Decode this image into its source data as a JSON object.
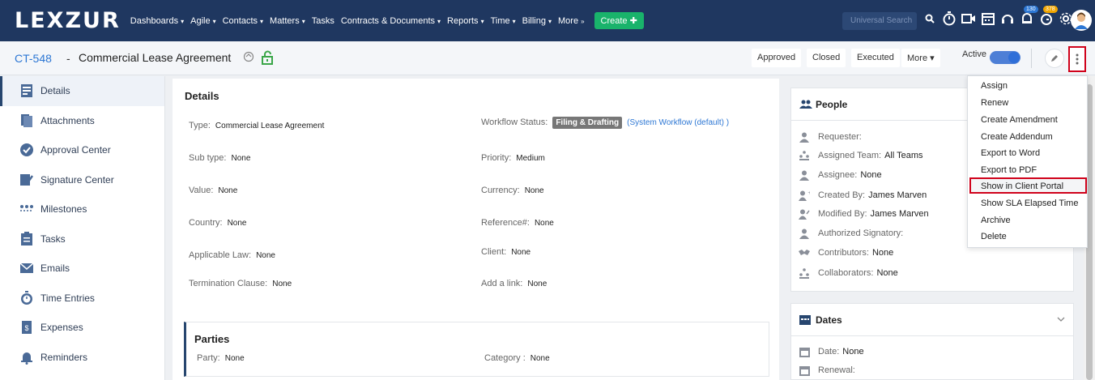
{
  "app": {
    "logo": "LEXZUR"
  },
  "nav": {
    "items": [
      {
        "label": "Dashboards",
        "caret": "▾"
      },
      {
        "label": "Agile",
        "caret": "▾"
      },
      {
        "label": "Contacts",
        "caret": "▾"
      },
      {
        "label": "Matters",
        "caret": "▾"
      },
      {
        "label": "Tasks",
        "caret": ""
      },
      {
        "label": "Contracts & Documents",
        "caret": "▾"
      },
      {
        "label": "Reports",
        "caret": "▾"
      },
      {
        "label": "Time",
        "caret": "▾"
      },
      {
        "label": "Billing",
        "caret": "▾"
      },
      {
        "label": "More",
        "caret": "»"
      }
    ],
    "create_label": "Create ✚",
    "search_placeholder": "Universal Search",
    "badge_notifications": "130",
    "badge_reminders": "378"
  },
  "record": {
    "id": "CT-548",
    "separator": "-",
    "title": "Commercial Lease Agreement",
    "status_buttons": [
      "Approved",
      "Closed",
      "Executed"
    ],
    "more_label": "More ▾",
    "active_label": "Active"
  },
  "sidebar": {
    "items": [
      {
        "label": "Details",
        "icon": "details-icon"
      },
      {
        "label": "Attachments",
        "icon": "attachments-icon"
      },
      {
        "label": "Approval Center",
        "icon": "approval-icon"
      },
      {
        "label": "Signature Center",
        "icon": "signature-icon"
      },
      {
        "label": "Milestones",
        "icon": "milestones-icon"
      },
      {
        "label": "Tasks",
        "icon": "tasks-icon"
      },
      {
        "label": "Emails",
        "icon": "email-icon"
      },
      {
        "label": "Time Entries",
        "icon": "stopwatch-icon"
      },
      {
        "label": "Expenses",
        "icon": "expenses-icon"
      },
      {
        "label": "Reminders",
        "icon": "bell-icon"
      }
    ]
  },
  "details": {
    "title": "Details",
    "type_label": "Type:",
    "type_value": "Commercial Lease Agreement",
    "subtype_label": "Sub type:",
    "subtype_value": "None",
    "value_label": "Value:",
    "value_value": "None",
    "country_label": "Country:",
    "country_value": "None",
    "law_label": "Applicable Law:",
    "law_value": "None",
    "termination_label": "Termination Clause:",
    "termination_value": "None",
    "workflow_label": "Workflow Status:",
    "workflow_badge": "Filing & Drafting",
    "workflow_link": "(System Workflow (default) )",
    "priority_label": "Priority:",
    "priority_value": "Medium",
    "currency_label": "Currency:",
    "currency_value": "None",
    "reference_label": "Reference#:",
    "reference_value": "None",
    "client_label": "Client:",
    "client_value": "None",
    "link_label": "Add a link:",
    "link_value": "None"
  },
  "parties": {
    "title": "Parties",
    "party_label": "Party:",
    "party_value": "None",
    "category_label": "Category :",
    "category_value": "None"
  },
  "people": {
    "title": "People",
    "items": [
      {
        "label": "Requester:",
        "value": ""
      },
      {
        "label": "Assigned Team:",
        "value": "All Teams"
      },
      {
        "label": "Assignee:",
        "value": "None"
      },
      {
        "label": "Created By:",
        "value": "James Marven"
      },
      {
        "label": "Modified By:",
        "value": "James Marven"
      },
      {
        "label": "Authorized Signatory:",
        "value": ""
      },
      {
        "label": "Contributors:",
        "value": "None"
      },
      {
        "label": "Collaborators:",
        "value": "None"
      }
    ]
  },
  "dates": {
    "title": "Dates",
    "date_label": "Date:",
    "date_value": "None",
    "renewal_label": "Renewal:"
  },
  "dropdown": {
    "items": [
      "Assign",
      "Renew",
      "Create Amendment",
      "Create Addendum",
      "Export to Word",
      "Export to PDF",
      "Show in Client Portal",
      "Show SLA Elapsed Time",
      "Archive",
      "Delete"
    ],
    "highlighted": "Show in Client Portal"
  },
  "colors": {
    "navbar": "#1f3760",
    "accent": "#2d77d4",
    "create": "#19b36b",
    "highlight": "#d0021b"
  }
}
